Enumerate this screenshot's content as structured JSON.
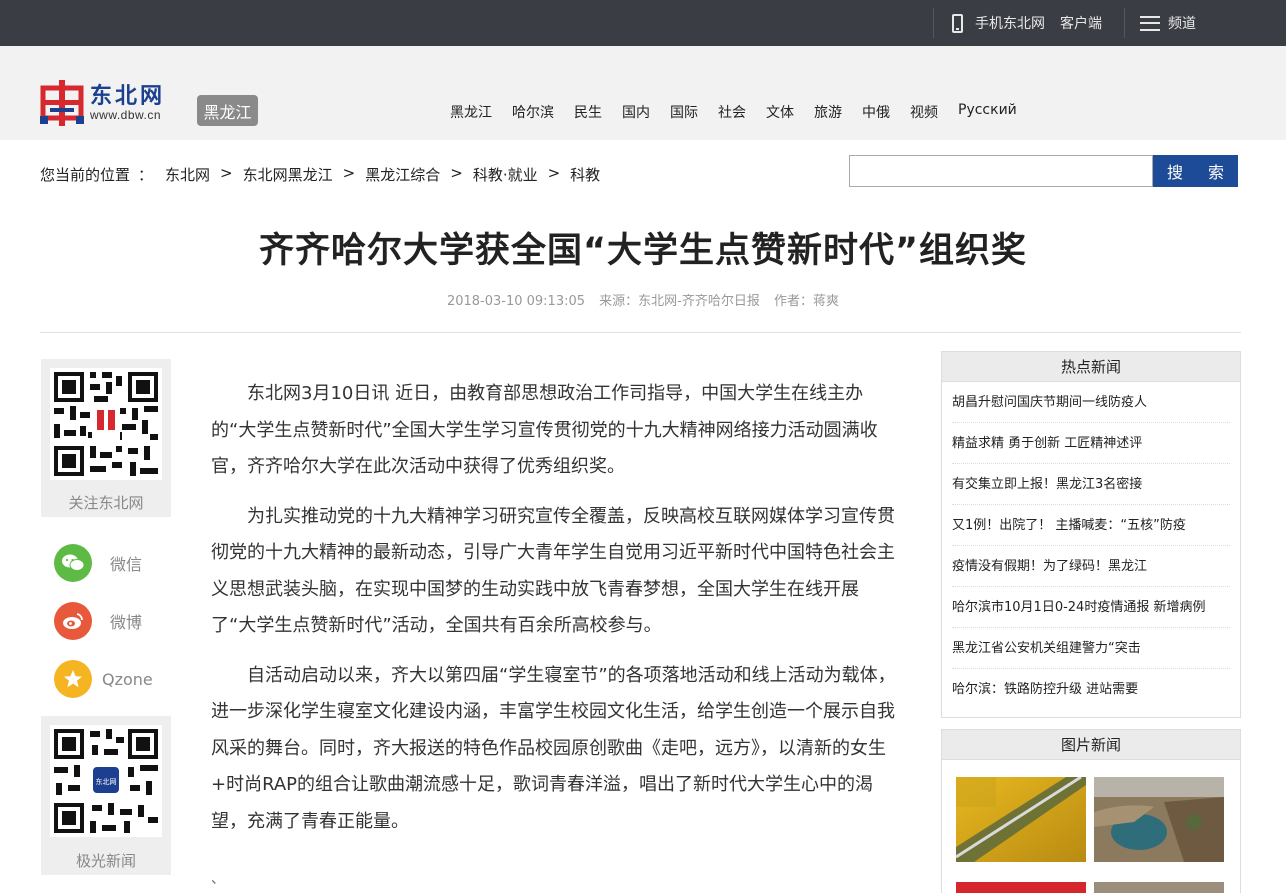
{
  "topbar": {
    "mobile_label": "手机东北网",
    "client_label": "客户端",
    "channel_label": "频道"
  },
  "header": {
    "logo_cn": "东北网",
    "logo_url": "www.dbw.cn",
    "region_badge": "黑龙江",
    "nav": [
      "黑龙江",
      "哈尔滨",
      "民生",
      "国内",
      "国际",
      "社会",
      "文体",
      "旅游",
      "中俄",
      "视频",
      "Русский"
    ]
  },
  "breadcrumb": {
    "prefix": "您当前的位置",
    "colon": "：",
    "separator": ">",
    "items": [
      "东北网",
      "东北网黑龙江",
      "黑龙江综合",
      "科教·就业",
      "科教"
    ]
  },
  "search": {
    "value": "",
    "button_label": "搜 索"
  },
  "article": {
    "title": "齐齐哈尔大学获全国“大学生点赞新时代”组织奖",
    "date": "2018-03-10 09:13:05",
    "source": "来源：东北网-齐齐哈尔日报",
    "author": "作者：蒋爽",
    "paragraphs": [
      "东北网3月10日讯 近日，由教育部思想政治工作司指导，中国大学生在线主办的“大学生点赞新时代”全国大学生学习宣传贯彻党的十九大精神网络接力活动圆满收官，齐齐哈尔大学在此次活动中获得了优秀组织奖。",
      "为扎实推动党的十九大精神学习研究宣传全覆盖，反映高校互联网媒体学习宣传贯彻党的十九大精神的最新动态，引导广大青年学生自觉用习近平新时代中国特色社会主义思想武装头脑，在实现中国梦的生动实践中放飞青春梦想，全国大学生在线开展了“大学生点赞新时代”活动，全国共有百余所高校参与。",
      "自活动启动以来，齐大以第四届“学生寝室节”的各项落地活动和线上活动为载体，进一步深化学生寝室文化建设内涵，丰富学生校园文化生活，给学生创造一个展示自我风采的舞台。同时，齐大报送的特色作品校园原创歌曲《走吧，远方》，以清新的女生+时尚RAP的组合让歌曲潮流感十足，歌词青春洋溢，唱出了新时代大学生心中的渴望，充满了青春正能量。"
    ],
    "tail_mark": "、"
  },
  "share": {
    "qr1_label": "关注东北网",
    "qr1_center": "东北网",
    "wechat_label": "微信",
    "weibo_label": "微博",
    "qzone_label": "Qzone",
    "qr2_label": "极光新闻",
    "qr2_center": "东北网"
  },
  "hot_news": {
    "heading": "热点新闻",
    "items": [
      "胡昌升慰问国庆节期间一线防疫人",
      "精益求精 勇于创新 工匠精神述评",
      "有交集立即上报！黑龙江3名密接",
      "又1例！出院了！ 主播喊麦：“五核”防疫",
      "疫情没有假期！为了绿码！黑龙江",
      "哈尔滨市10月1日0-24时疫情通报 新增病例",
      "黑龙江省公安机关组建警力“突击",
      "哈尔滨：铁路防控升级 进站需要"
    ]
  },
  "photo_news": {
    "heading": "图片新闻"
  },
  "colors": {
    "topbar": "#3a3d44",
    "brand_blue": "#1e4b97",
    "logo_red": "#d7282e",
    "wechat": "#5dbb45",
    "weibo": "#e8583b",
    "qzone": "#f5b523"
  }
}
